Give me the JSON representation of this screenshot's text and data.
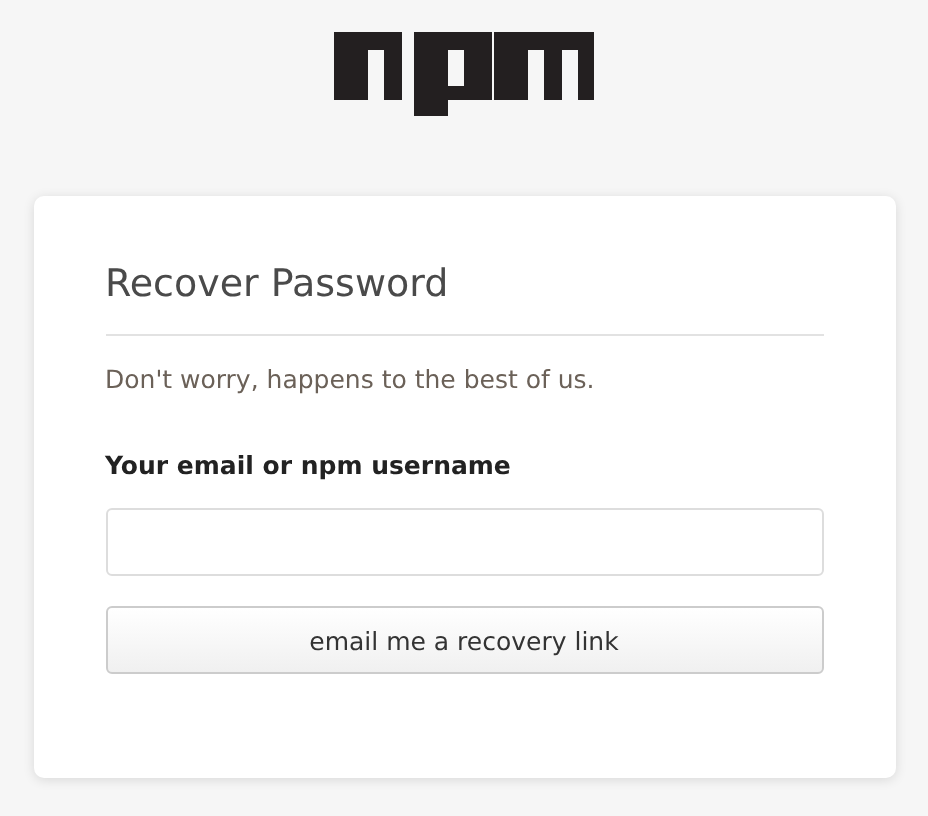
{
  "card": {
    "title": "Recover Password",
    "message": "Don't worry, happens to the best of us.",
    "field": {
      "label": "Your email or npm username"
    },
    "button": "email me a recovery link"
  }
}
